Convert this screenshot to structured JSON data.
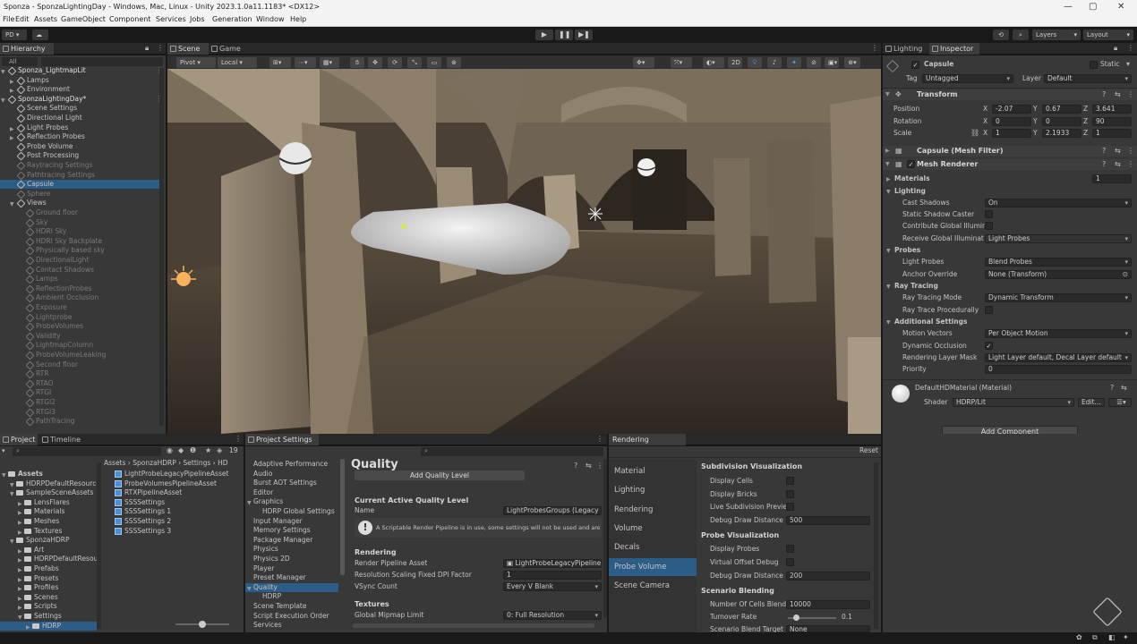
{
  "window": {
    "title": "Sponza - SponzaLightingDay - Windows, Mac, Linux - Unity 2023.1.0a11.1183* <DX12>"
  },
  "menu": [
    "File",
    "Edit",
    "Assets",
    "GameObject",
    "Component",
    "Services",
    "Jobs",
    "Generation",
    "Window",
    "Help"
  ],
  "toolbar": {
    "account": "PD",
    "layers": "Layers",
    "layout": "Layout"
  },
  "hierarchy": {
    "tab": "Hierarchy",
    "search": "All",
    "items": [
      {
        "label": "Sponza_LightmapLit",
        "depth": 0,
        "expanded": true,
        "scene": true
      },
      {
        "label": "Lamps",
        "depth": 1,
        "arrow": true
      },
      {
        "label": "Environment",
        "depth": 1,
        "arrow": true
      },
      {
        "label": "SponzaLightingDay*",
        "depth": 0,
        "expanded": true,
        "scene": true
      },
      {
        "label": "Scene Settings",
        "depth": 1
      },
      {
        "label": "Directional Light",
        "depth": 1
      },
      {
        "label": "Light Probes",
        "depth": 1,
        "arrow": true
      },
      {
        "label": "Reflection Probes",
        "depth": 1,
        "arrow": true
      },
      {
        "label": "Probe Volume",
        "depth": 1
      },
      {
        "label": "Post Processing",
        "depth": 1
      },
      {
        "label": "Raytracing Settings",
        "depth": 1,
        "dim": true
      },
      {
        "label": "Pathtracing Settings",
        "depth": 1,
        "dim": true
      },
      {
        "label": "Capsule",
        "depth": 1,
        "selected": true
      },
      {
        "label": "Sphere",
        "depth": 1,
        "dim": true
      },
      {
        "label": "Views",
        "depth": 1,
        "expanded": true
      },
      {
        "label": "Ground floor",
        "depth": 2,
        "dim": true
      },
      {
        "label": "Sky",
        "depth": 2,
        "dim": true
      },
      {
        "label": "HDRI Sky",
        "depth": 2,
        "dim": true
      },
      {
        "label": "HDRI Sky Backplate",
        "depth": 2,
        "dim": true
      },
      {
        "label": "Physically based sky",
        "depth": 2,
        "dim": true
      },
      {
        "label": "DirectionalLight",
        "depth": 2,
        "dim": true
      },
      {
        "label": "Contact Shadows",
        "depth": 2,
        "dim": true
      },
      {
        "label": "Lamps",
        "depth": 2,
        "dim": true
      },
      {
        "label": "ReflectionProbes",
        "depth": 2,
        "dim": true
      },
      {
        "label": "Ambient Occlusion",
        "depth": 2,
        "dim": true
      },
      {
        "label": "Exposure",
        "depth": 2,
        "dim": true
      },
      {
        "label": "Lightprobe",
        "depth": 2,
        "dim": true
      },
      {
        "label": "ProbeVolumes",
        "depth": 2,
        "dim": true
      },
      {
        "label": "Validity",
        "depth": 2,
        "dim": true
      },
      {
        "label": "LightmapColumn",
        "depth": 2,
        "dim": true
      },
      {
        "label": "ProbeVolumeLeaking",
        "depth": 2,
        "dim": true
      },
      {
        "label": "Second floor",
        "depth": 2,
        "dim": true
      },
      {
        "label": "RTR",
        "depth": 2,
        "dim": true
      },
      {
        "label": "RTAO",
        "depth": 2,
        "dim": true
      },
      {
        "label": "RTGI",
        "depth": 2,
        "dim": true
      },
      {
        "label": "RTGI2",
        "depth": 2,
        "dim": true
      },
      {
        "label": "RTGI3",
        "depth": 2,
        "dim": true
      },
      {
        "label": "PathTracing",
        "depth": 2,
        "dim": true
      }
    ]
  },
  "scene": {
    "tabs": [
      "Scene",
      "Game"
    ],
    "pivot": "Pivot",
    "local": "Local",
    "mode2d": "2D"
  },
  "inspector": {
    "tabs": [
      "Lighting",
      "Inspector"
    ],
    "object_name": "Capsule",
    "static_label": "Static",
    "tag_label": "Tag",
    "tag": "Untagged",
    "layer_label": "Layer",
    "layer": "Default",
    "transform": {
      "title": "Transform",
      "position_label": "Position",
      "position": [
        "-2.07",
        "0.67",
        "3.641"
      ],
      "rotation_label": "Rotation",
      "rotation": [
        "0",
        "0",
        "90"
      ],
      "scale_label": "Scale",
      "scale": [
        "1",
        "2.1933",
        "1"
      ],
      "axes": [
        "X",
        "Y",
        "Z"
      ]
    },
    "mesh_filter": "Capsule (Mesh Filter)",
    "mesh_renderer": {
      "title": "Mesh Renderer",
      "materials_label": "Materials",
      "materials_count": "1",
      "lighting_label": "Lighting",
      "cast_shadows_label": "Cast Shadows",
      "cast_shadows": "On",
      "static_shadow_caster": "Static Shadow Caster",
      "contribute_gi": "Contribute Global Illumin",
      "receive_gi_label": "Receive Global Illuminat",
      "receive_gi": "Light Probes",
      "probes_label": "Probes",
      "light_probes_label": "Light Probes",
      "light_probes": "Blend Probes",
      "anchor_override_label": "Anchor Override",
      "anchor_override": "None (Transform)",
      "ray_tracing_label": "Ray Tracing",
      "ray_tracing_mode_label": "Ray Tracing Mode",
      "ray_tracing_mode": "Dynamic Transform",
      "ray_trace_procedurally": "Ray Trace Procedurally",
      "additional_label": "Additional Settings",
      "motion_vectors_label": "Motion Vectors",
      "motion_vectors": "Per Object Motion",
      "dynamic_occlusion": "Dynamic Occlusion",
      "rendering_layer_mask_label": "Rendering Layer Mask",
      "rendering_layer_mask": "Light Layer default, Decal Layer default",
      "priority_label": "Priority",
      "priority": "0"
    },
    "material": {
      "name": "DefaultHDMaterial (Material)",
      "shader_label": "Shader",
      "shader": "HDRP/Lit",
      "edit": "Edit..."
    },
    "add_component": "Add Component"
  },
  "project": {
    "tabs": [
      "Project",
      "Timeline"
    ],
    "breadcrumb": [
      "Assets",
      "SponzaHDRP",
      "Settings",
      "HD"
    ],
    "count": "19",
    "tree": [
      {
        "label": "Assets",
        "depth": 0,
        "bold": true
      },
      {
        "label": "HDRPDefaultResource",
        "depth": 1
      },
      {
        "label": "SampleSceneAssets",
        "depth": 1
      },
      {
        "label": "LensFlares",
        "depth": 2
      },
      {
        "label": "Materials",
        "depth": 2
      },
      {
        "label": "Meshes",
        "depth": 2
      },
      {
        "label": "Textures",
        "depth": 2
      },
      {
        "label": "SponzaHDRP",
        "depth": 1
      },
      {
        "label": "Art",
        "depth": 2
      },
      {
        "label": "HDRPDefaultResour",
        "depth": 2
      },
      {
        "label": "Prefabs",
        "depth": 2
      },
      {
        "label": "Presets",
        "depth": 2
      },
      {
        "label": "Profiles",
        "depth": 2
      },
      {
        "label": "Scenes",
        "depth": 2
      },
      {
        "label": "Scripts",
        "depth": 2
      },
      {
        "label": "Settings",
        "depth": 2
      },
      {
        "label": "HDRP",
        "depth": 3,
        "selected": true
      }
    ],
    "files": [
      "LightProbeLegacyPipelineAsset",
      "ProbeVolumesPipelineAsset",
      "RTXPipelineAsset",
      "SSSSettings",
      "SSSSettings 1",
      "SSSSettings 2",
      "SSSSettings 3"
    ]
  },
  "project_settings": {
    "tab": "Project Settings",
    "categories": [
      {
        "label": "Adaptive Performance",
        "depth": 0
      },
      {
        "label": "Audio",
        "depth": 0
      },
      {
        "label": "Burst AOT Settings",
        "depth": 0
      },
      {
        "label": "Editor",
        "depth": 0
      },
      {
        "label": "Graphics",
        "depth": 0,
        "arrow": true
      },
      {
        "label": "HDRP Global Settings",
        "depth": 1
      },
      {
        "label": "Input Manager",
        "depth": 0
      },
      {
        "label": "Memory Settings",
        "depth": 0
      },
      {
        "label": "Package Manager",
        "depth": 0
      },
      {
        "label": "Physics",
        "depth": 0
      },
      {
        "label": "Physics 2D",
        "depth": 0
      },
      {
        "label": "Player",
        "depth": 0
      },
      {
        "label": "Preset Manager",
        "depth": 0
      },
      {
        "label": "Quality",
        "depth": 0,
        "arrow": true,
        "selected": true
      },
      {
        "label": "HDRP",
        "depth": 1
      },
      {
        "label": "Scene Template",
        "depth": 0
      },
      {
        "label": "Script Execution Order",
        "depth": 0
      },
      {
        "label": "Services",
        "depth": 0
      }
    ],
    "title": "Quality",
    "add_quality_level": "Add Quality Level",
    "current_level_label": "Current Active Quality Level",
    "name_label": "Name",
    "name": "LightProbesGroups (Legacy",
    "info": "A Scriptable Render Pipeline is in use, some settings will not be used and are h",
    "rendering_label": "Rendering",
    "rp_asset_label": "Render Pipeline Asset",
    "rp_asset": "LightProbeLegacyPipeline",
    "dpi_label": "Resolution Scaling Fixed DPI Factor",
    "dpi": "1",
    "vsync_label": "VSync Count",
    "vsync": "Every V Blank",
    "textures_label": "Textures",
    "mipmap_label": "Global Mipmap Limit",
    "mipmap": "0: Full Resolution"
  },
  "debugger": {
    "tab": "Rendering Debugger",
    "reset": "Reset",
    "nav": [
      "Material",
      "Lighting",
      "Rendering",
      "Volume",
      "Decals",
      "Probe Volume",
      "Scene Camera"
    ],
    "nav_selected": 5,
    "subdivision_label": "Subdivision Visualization",
    "display_cells": "Display Cells",
    "display_bricks": "Display Bricks",
    "live_subdivision": "Live Subdivision Previe",
    "debug_draw_distance_label": "Debug Draw Distance",
    "debug_draw_distance": "500",
    "probe_vis_label": "Probe Visualization",
    "display_probes": "Display Probes",
    "virtual_offset": "Virtual Offset Debug",
    "probe_draw_distance_label": "Debug Draw Distance",
    "probe_draw_distance": "200",
    "scenario_label": "Scenario Blending",
    "cells_blend_label": "Number Of Cells Blend",
    "cells_blend": "10000",
    "turnover_label": "Turnover Rate",
    "turnover": "0.1",
    "turnover_fraction": 0.1,
    "scenario_target": "Scenario Blend Target",
    "scenario_target_value": "None"
  }
}
